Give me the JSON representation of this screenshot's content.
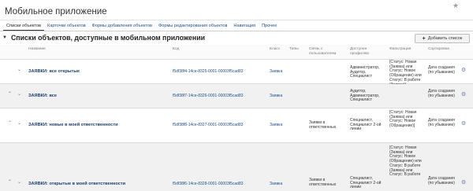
{
  "page": {
    "title": "Мобильное приложение",
    "star_glyph": "★"
  },
  "tabs": [
    {
      "label": "Списки объектов",
      "active": true
    },
    {
      "label": "Карточки объектов",
      "active": false
    },
    {
      "label": "Формы добавления объектов",
      "active": false
    },
    {
      "label": "Формы редактирования объектов",
      "active": false
    },
    {
      "label": "Навигация",
      "active": false
    },
    {
      "label": "Прочее",
      "active": false
    }
  ],
  "section": {
    "collapse_glyph": "▼",
    "title": "Списки объектов, доступные в мобильном приложении",
    "add_button": {
      "icon": "plus-icon",
      "glyph": "+",
      "label": "Добавить список"
    }
  },
  "table": {
    "headers": {
      "name": "Название",
      "code": "Код",
      "class": "Класс",
      "types": "Типы",
      "user_link": "Связь с пользователем",
      "profiles": "Доступен профилям",
      "filter": "Фильтрация",
      "sort": "Сортировка"
    },
    "icons": {
      "move": "chevron-up-down-icon",
      "settings": "settings-icon"
    },
    "glyphs": {
      "up": "⌃",
      "down": "⌄",
      "settings": "⚙"
    },
    "rows": [
      {
        "name": "ЗАЯВКИ: все открытые",
        "code": "f5df38f4-14ce-8325-0001-00003f5cad83",
        "class": "Заявка",
        "types": "",
        "user_link": "",
        "profiles": "Администратор, Аудитор, Специалист",
        "filter": "[Статус: Новая (Заявка) или Статус: Новое (Обращение) или Статус: В работе (Заявка)]",
        "sort": "Дата создания (по убыванию)",
        "show_up": false
      },
      {
        "name": "ЗАЯВКИ: все",
        "code": "f5df38f7-14ce-8326-0001-00003f5cad83",
        "class": "Заявка",
        "types": "",
        "user_link": "",
        "profiles": "Аудитор, Администратор, Специалист",
        "filter": "",
        "sort": "Дата создания (по убыванию)",
        "show_up": true
      },
      {
        "name": "ЗАЯВКИ: новые в моей ответственности",
        "code": "f5df38f8-14ce-8327-0001-00003f5cad83",
        "class": "Заявка",
        "types": "",
        "user_link": "Заявки в ответственных",
        "profiles": "Специалист, Специалист 2-ой линии",
        "filter": "[Статус: Новая (Заявка) или Статус: Новое (Обращение)]",
        "sort": "Дата создания (по убыванию)",
        "show_up": true
      },
      {
        "name": "ЗАЯВКИ: открытые в моей ответственности",
        "code": "f5df38f6-14ce-8328-0001-00003f5cad83",
        "class": "Заявка",
        "types": "",
        "user_link": "Заявки в ответственных",
        "profiles": "Специалист, Специалист 2-ой линии",
        "filter": "[Статус: Новая (Заявка) или Статус: Новое (Обращение) или Статус: В работе (Заявка) или Статус: В работе",
        "sort": "Дата создания (по убыванию)",
        "show_up": true
      }
    ]
  }
}
